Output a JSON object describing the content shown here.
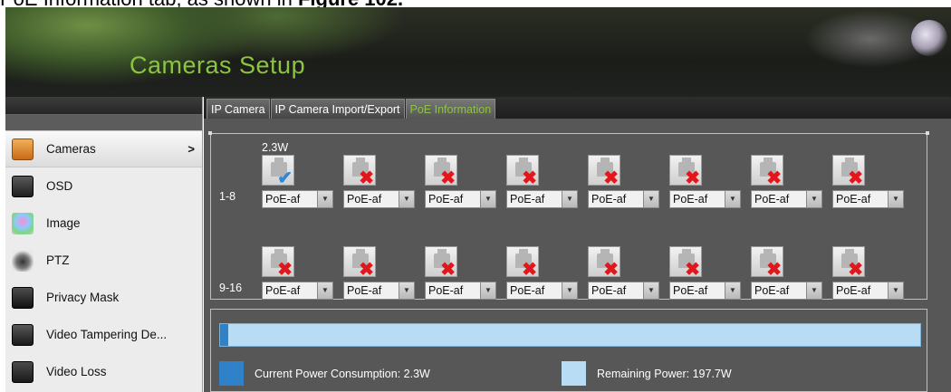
{
  "caption": {
    "prefix": "PoE Information tab, as shown in ",
    "bold": "Figure 102.",
    "suffix": ""
  },
  "header": {
    "title": "Cameras Setup"
  },
  "sidebar": {
    "items": [
      {
        "label": "Cameras",
        "icon": "camera-folder-icon",
        "active": true,
        "arrow": ">"
      },
      {
        "label": "OSD",
        "icon": "osd-icon"
      },
      {
        "label": "Image",
        "icon": "image-color-icon"
      },
      {
        "label": "PTZ",
        "icon": "ptz-dome-icon"
      },
      {
        "label": "Privacy Mask",
        "icon": "privacy-mask-icon"
      },
      {
        "label": "Video Tampering De...",
        "icon": "video-tampering-icon"
      },
      {
        "label": "Video Loss",
        "icon": "video-loss-icon"
      }
    ]
  },
  "tabs": [
    {
      "label": "IP Camera"
    },
    {
      "label": "IP Camera Import/Export"
    },
    {
      "label": "PoE Information",
      "active": true
    }
  ],
  "poe": {
    "power_label": "2.3W",
    "rows": [
      {
        "label": "1-8",
        "ports": [
          {
            "status": "connected",
            "mode": "PoE-af"
          },
          {
            "status": "disconnected",
            "mode": "PoE-af"
          },
          {
            "status": "disconnected",
            "mode": "PoE-af"
          },
          {
            "status": "disconnected",
            "mode": "PoE-af"
          },
          {
            "status": "disconnected",
            "mode": "PoE-af"
          },
          {
            "status": "disconnected",
            "mode": "PoE-af"
          },
          {
            "status": "disconnected",
            "mode": "PoE-af"
          },
          {
            "status": "disconnected",
            "mode": "PoE-af"
          }
        ]
      },
      {
        "label": "9-16",
        "ports": [
          {
            "status": "disconnected",
            "mode": "PoE-af"
          },
          {
            "status": "disconnected",
            "mode": "PoE-af"
          },
          {
            "status": "disconnected",
            "mode": "PoE-af"
          },
          {
            "status": "disconnected",
            "mode": "PoE-af"
          },
          {
            "status": "disconnected",
            "mode": "PoE-af"
          },
          {
            "status": "disconnected",
            "mode": "PoE-af"
          },
          {
            "status": "disconnected",
            "mode": "PoE-af"
          },
          {
            "status": "disconnected",
            "mode": "PoE-af"
          }
        ]
      }
    ]
  },
  "power": {
    "used_fraction": 0.0115,
    "current_label": "Current Power Consumption: 2.3W",
    "remaining_label": "Remaining Power: 197.7W",
    "colors": {
      "current": "#2f82c8",
      "remaining": "#b9dcf5"
    }
  }
}
